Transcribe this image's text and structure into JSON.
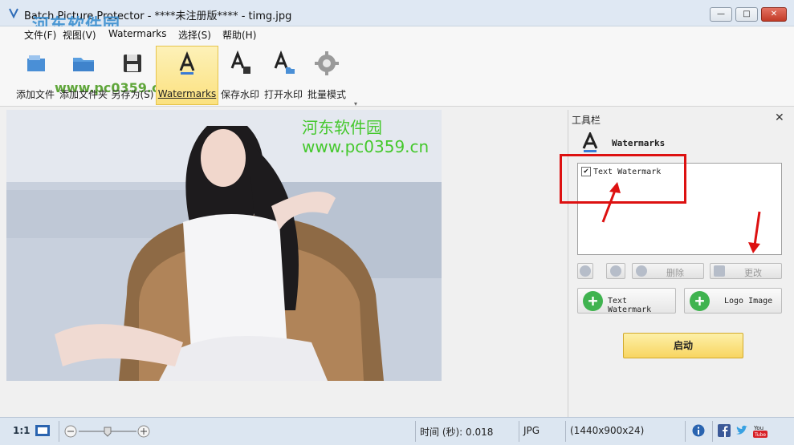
{
  "window": {
    "title": "Batch Picture Protector - ****未注册版**** - timg.jpg",
    "controls": {
      "minimize": "—",
      "maximize": "□",
      "close": "✕"
    }
  },
  "site_watermark": {
    "name": "河东软件园",
    "url": "www.pc0359.cn"
  },
  "menu": [
    "文件(F)",
    "视图(V)",
    "Watermarks",
    "选择(S)",
    "帮助(H)"
  ],
  "toolbar": {
    "items": [
      {
        "label": "添加文件",
        "icon": "add-file-icon"
      },
      {
        "label": "添加文件夹",
        "icon": "add-folder-icon"
      },
      {
        "label": "另存为(S)",
        "icon": "save-icon"
      },
      {
        "label": "Watermarks",
        "icon": "watermark-icon",
        "active": true
      },
      {
        "label": "保存水印",
        "icon": "save-watermark-icon"
      },
      {
        "label": "打开水印",
        "icon": "open-watermark-icon"
      },
      {
        "label": "批量模式",
        "icon": "gear-icon"
      }
    ],
    "grip": "▾"
  },
  "image_watermark": {
    "text_cn": "河东软件园",
    "text_url": "www.pc0359.cn"
  },
  "panel": {
    "title": "工具栏",
    "close": "✕",
    "heading": "Watermarks",
    "list": [
      {
        "label": "Text Watermark",
        "checked": true
      }
    ],
    "controls": {
      "up": "up-icon",
      "down": "down-icon",
      "delete": "删除",
      "edit": "更改"
    },
    "add_text_watermark": "Text Watermark",
    "add_logo_image": "Logo Image",
    "start": "启动"
  },
  "status": {
    "zoom_ratio": "1:1",
    "time_label": "时间 (秒): 0.018",
    "format": "JPG",
    "dimensions": "(1440x900x24)"
  },
  "colors": {
    "accent_active": "#fbe17f",
    "annotation_red": "#d11111",
    "watermark_green": "#45c82d"
  }
}
